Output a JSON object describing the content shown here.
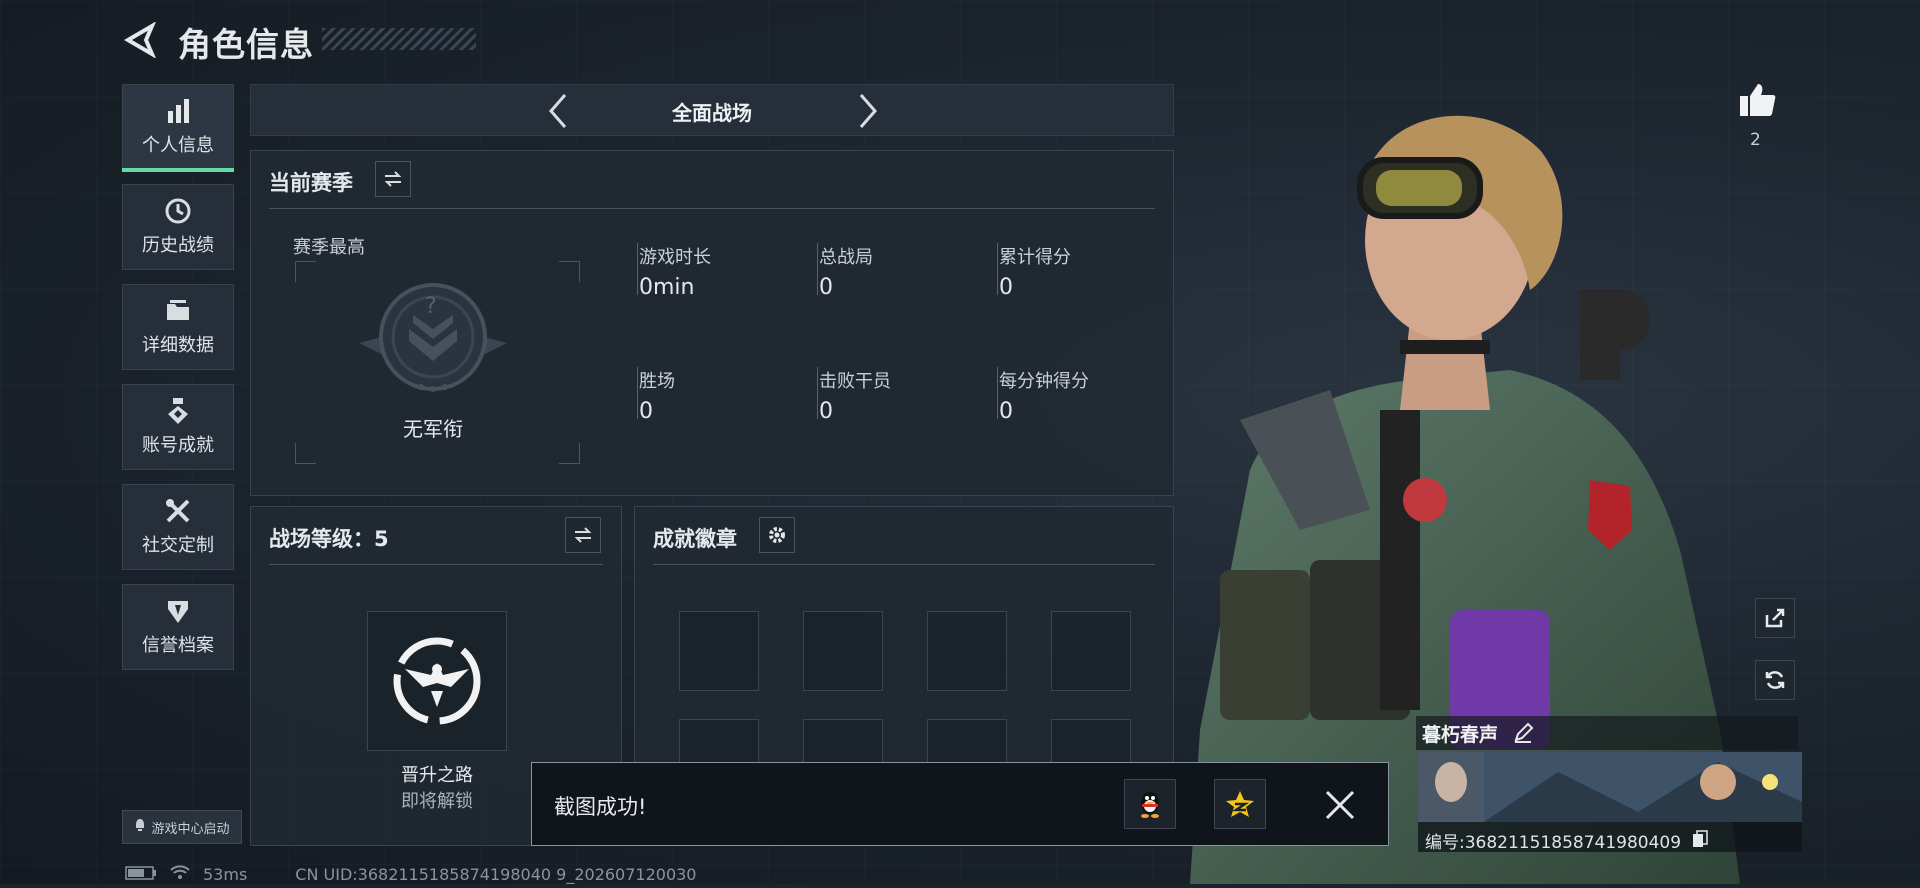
{
  "header": {
    "title": "角色信息"
  },
  "sidebar": {
    "items": [
      {
        "label": "个人信息",
        "icon": "bar-chart-icon",
        "active": true
      },
      {
        "label": "历史战绩",
        "icon": "clock-history-icon",
        "active": false
      },
      {
        "label": "详细数据",
        "icon": "folder-icon",
        "active": false
      },
      {
        "label": "账号成就",
        "icon": "medal-icon",
        "active": false
      },
      {
        "label": "社交定制",
        "icon": "tools-icon",
        "active": false
      },
      {
        "label": "信誉档案",
        "icon": "shield-badge-icon",
        "active": false
      }
    ],
    "game_center": "游戏中心启动"
  },
  "mode": {
    "label": "全面战场"
  },
  "season": {
    "title": "当前赛季",
    "best_label": "赛季最高",
    "rank_name": "无军衔",
    "stats": [
      {
        "label": "游戏时长",
        "value": "0min"
      },
      {
        "label": "总战局",
        "value": "0"
      },
      {
        "label": "累计得分",
        "value": "0"
      },
      {
        "label": "胜场",
        "value": "0"
      },
      {
        "label": "击败干员",
        "value": "0"
      },
      {
        "label": "每分钟得分",
        "value": "0"
      }
    ]
  },
  "battlefield": {
    "title": "战场等级：5",
    "emblem_title": "晋升之路",
    "emblem_sub": "即将解锁"
  },
  "achievements": {
    "title": "成就徽章"
  },
  "toast": {
    "message": "截图成功!"
  },
  "profile": {
    "likes": "2",
    "player_name": "暮朽春声",
    "uid": "编号:3682115185874198040​9"
  },
  "status_bar": {
    "ping": "53ms",
    "cn_uid": "CN UID:3682115185874198040 9_202607120030"
  },
  "colors": {
    "accent": "#66d9a4",
    "background": "#1b232c",
    "panel": "#212932"
  }
}
